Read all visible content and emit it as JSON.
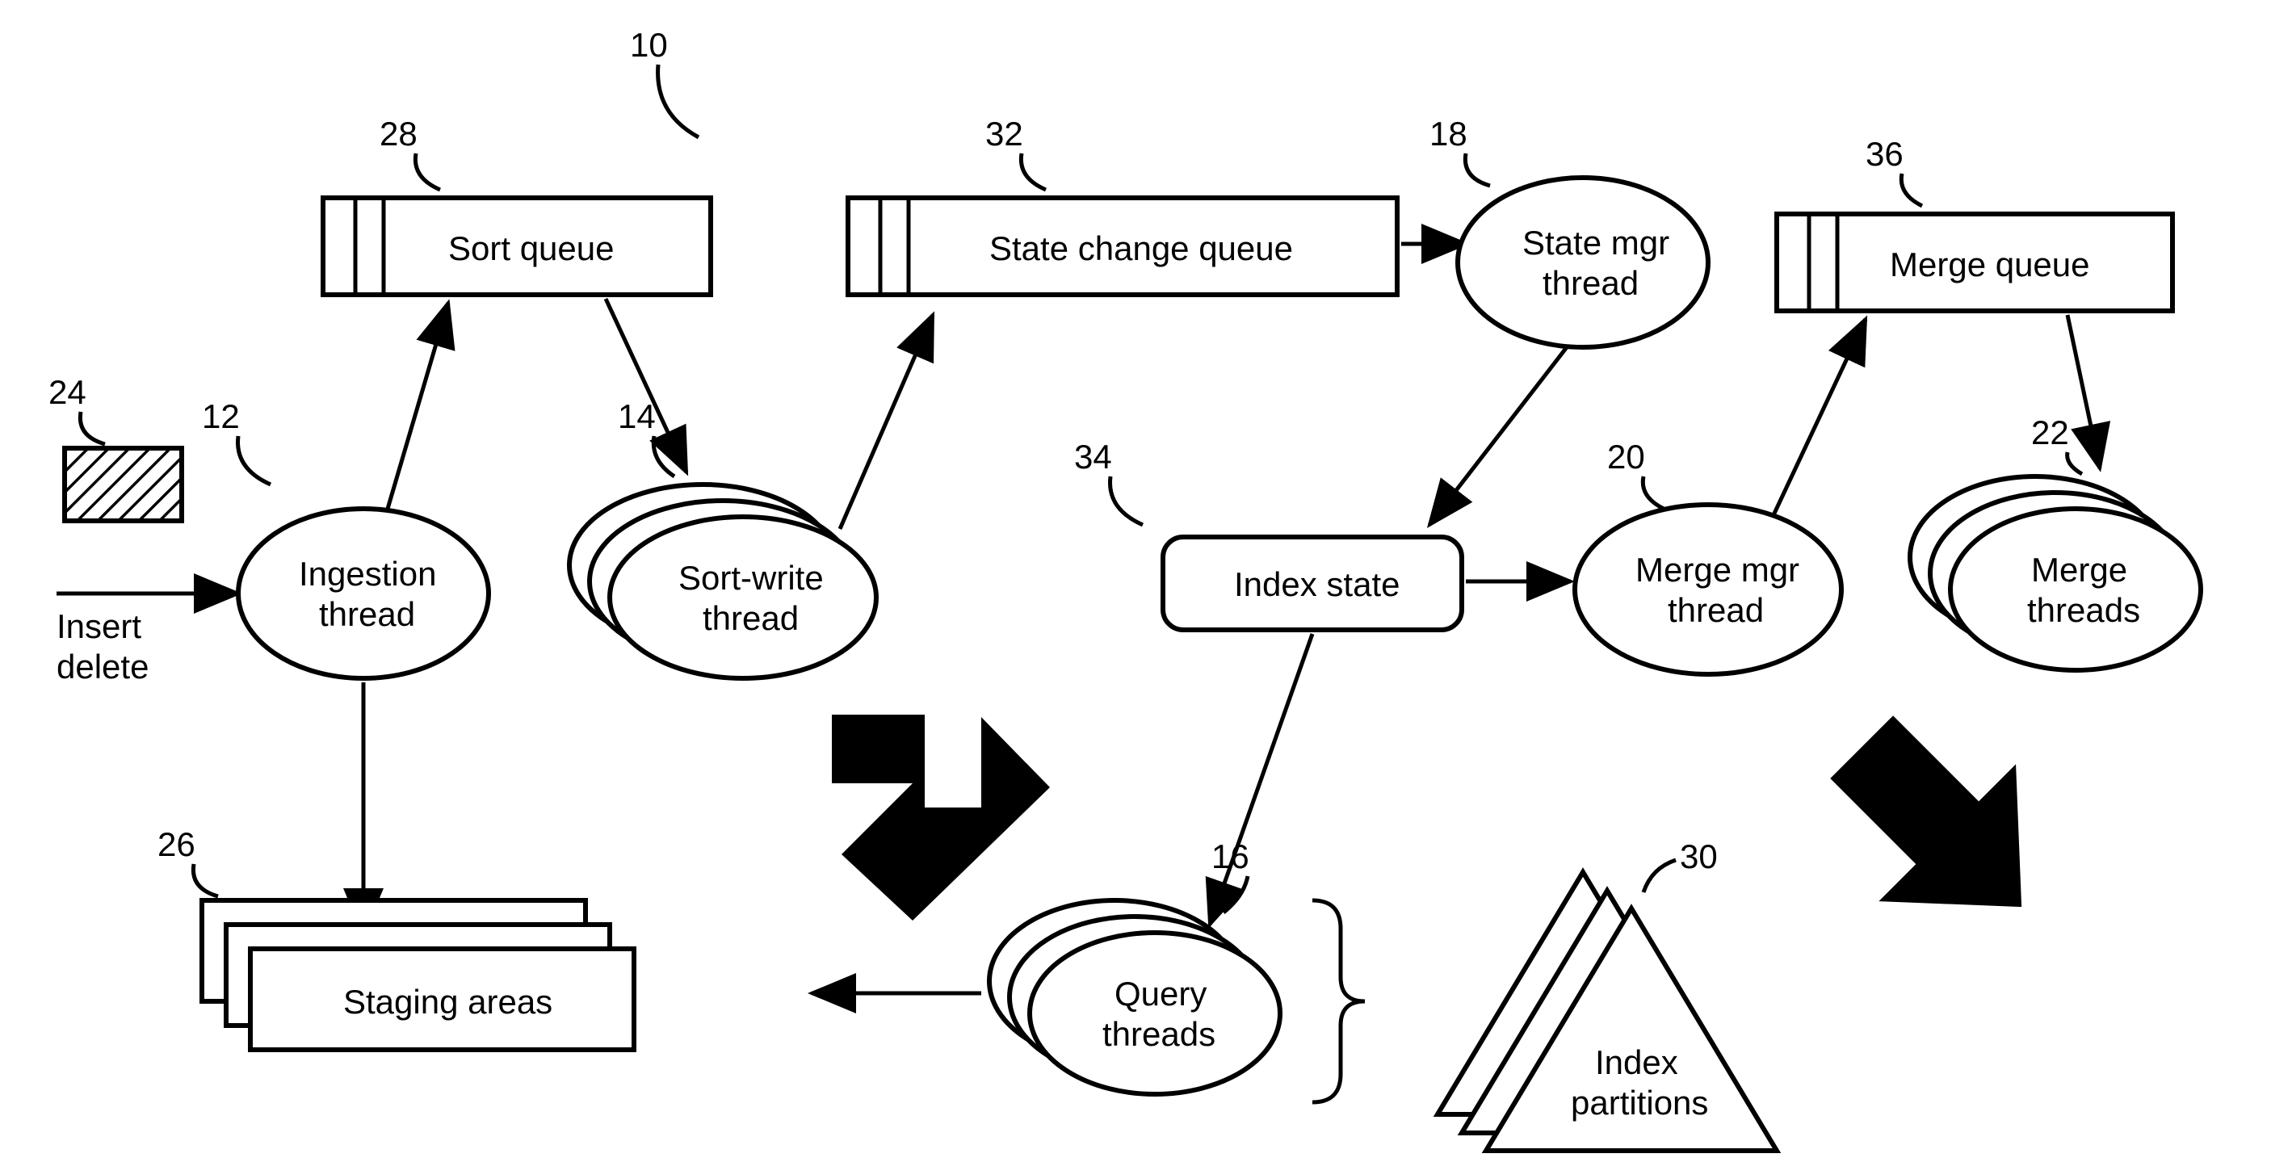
{
  "diagram": {
    "refs": {
      "r10": "10",
      "r12": "12",
      "r14": "14",
      "r16": "16",
      "r18": "18",
      "r20": "20",
      "r22": "22",
      "r24": "24",
      "r26": "26",
      "r28": "28",
      "r30": "30",
      "r32": "32",
      "r34": "34",
      "r36": "36"
    },
    "labels": {
      "insert": "Insert",
      "delete": "delete",
      "ingestion1": "Ingestion",
      "ingestion2": "thread",
      "sortqueue": "Sort queue",
      "sortwrite1": "Sort-write",
      "sortwrite2": "thread",
      "staging": "Staging areas",
      "statechange": "State change queue",
      "statemgr1": "State mgr",
      "statemgr2": "thread",
      "indexstate": "Index state",
      "mergemgr1": "Merge mgr",
      "mergemgr2": "thread",
      "mergequeue": "Merge queue",
      "merge1": "Merge",
      "merge2": "threads",
      "query1": "Query",
      "query2": "threads",
      "indexpart1": "Index",
      "indexpart2": "partitions"
    }
  }
}
